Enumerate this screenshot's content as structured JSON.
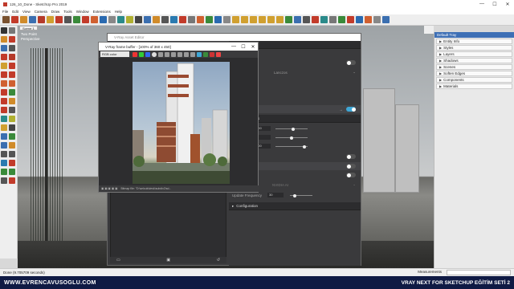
{
  "window": {
    "title": "126_10_Done - SketchUp Pro 2019"
  },
  "menu": [
    "File",
    "Edit",
    "View",
    "Camera",
    "Draw",
    "Tools",
    "Window",
    "Extensions",
    "Help"
  ],
  "scene_tab": "Scene 1",
  "viewport_labels": [
    "Two Point",
    "Perspective"
  ],
  "asset_editor": {
    "title": "V-Ray Asset Editor",
    "rows": [
      {
        "label": "ment",
        "kind": "header"
      },
      {
        "label": "ter",
        "kind": "toggle-off"
      },
      {
        "label": "Lanczos",
        "kind": "dropdown"
      },
      {
        "label": "2D",
        "kind": "plain"
      },
      {
        "label": "ection",
        "kind": "toggle-on"
      },
      {
        "label": "ness Parameters",
        "kind": "header"
      },
      {
        "label": "100",
        "kind": "field"
      },
      {
        "label": "8",
        "kind": "field"
      },
      {
        "label": "300",
        "kind": "field"
      },
      {
        "label": "nement",
        "kind": "toggle-off"
      },
      {
        "label": "NVIDIA AI",
        "kind": "dropdown"
      },
      {
        "label": "Update Frequency",
        "kind": "field"
      },
      {
        "label": "Configuration",
        "kind": "collapsed"
      }
    ],
    "update_frequency_value": "30",
    "param_labels": [
      "ol",
      "l"
    ]
  },
  "frame_buffer": {
    "title": "V-Ray frame buffer - [100% of 360 x 450]",
    "channel": "RGB color",
    "status": "Bitmap file: \"D:\\selcuk\\desk\\subdiv2\\sd..."
  },
  "tray": {
    "title": "Default Tray",
    "items": [
      "Entity Info",
      "Styles",
      "Layers",
      "Shadows",
      "Scenes",
      "Soften Edges",
      "Components",
      "Materials"
    ]
  },
  "status": {
    "text": "Done (9.705709 seconds)",
    "measurements_label": "Measurements"
  },
  "banner": {
    "url": "WWW.EVRENCAVUSOGLU.COM",
    "course": "VRAY NEXT FOR SKETCHUP EĞİTİM SETİ 2"
  },
  "colors": {
    "accent": "#3ea7d6",
    "banner": "#0f1a44",
    "tray_title": "#3d6fb5"
  }
}
